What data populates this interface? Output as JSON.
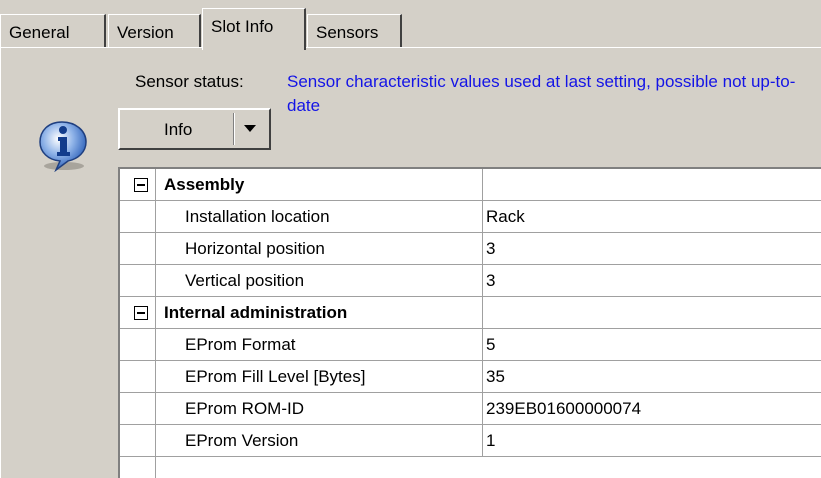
{
  "tabs": [
    {
      "label": "General",
      "active": false
    },
    {
      "label": "Version",
      "active": false
    },
    {
      "label": "Slot Info",
      "active": true
    },
    {
      "label": "Sensors",
      "active": false
    }
  ],
  "status": {
    "label": "Sensor status:",
    "text": "Sensor characteristic values used at last setting, possible not up-to-date"
  },
  "combo": {
    "label": "Info"
  },
  "grid": {
    "categories": [
      {
        "name": "Assembly",
        "expanded": true,
        "properties": [
          {
            "name": "Installation location",
            "value": "Rack"
          },
          {
            "name": "Horizontal position",
            "value": "3"
          },
          {
            "name": "Vertical position",
            "value": "3"
          }
        ]
      },
      {
        "name": "Internal administration",
        "expanded": true,
        "properties": [
          {
            "name": "EProm Format",
            "value": "5"
          },
          {
            "name": "EProm Fill Level [Bytes]",
            "value": "35"
          },
          {
            "name": "EProm ROM-ID",
            "value": "239EB01600000074"
          },
          {
            "name": "EProm Version",
            "value": "1"
          }
        ]
      }
    ]
  },
  "colors": {
    "status_text": "#1414e6",
    "background": "#d4d0c8"
  }
}
